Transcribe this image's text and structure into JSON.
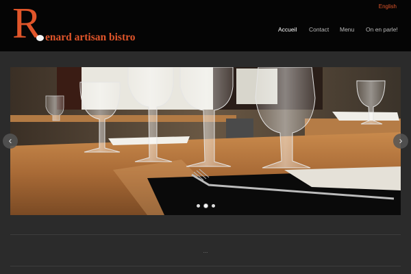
{
  "site": {
    "logo_initial": "R",
    "logo_rest": "enard artisan bistro"
  },
  "header": {
    "language": "English",
    "nav": [
      {
        "label": "Accueil",
        "active": true
      },
      {
        "label": "Contact",
        "active": false
      },
      {
        "label": "Menu",
        "active": false
      },
      {
        "label": "On en parle!",
        "active": false
      }
    ]
  },
  "slider": {
    "prev_icon": "chevron-left-icon",
    "next_icon": "chevron-right-icon",
    "prev_glyph": "‹",
    "next_glyph": "›",
    "slide_count": 3,
    "current_slide": 2
  },
  "footer": {
    "ellipsis": "..."
  },
  "colors": {
    "brand": "#e0552a",
    "header_bg": "#050505",
    "page_bg": "#2b2b2b"
  }
}
